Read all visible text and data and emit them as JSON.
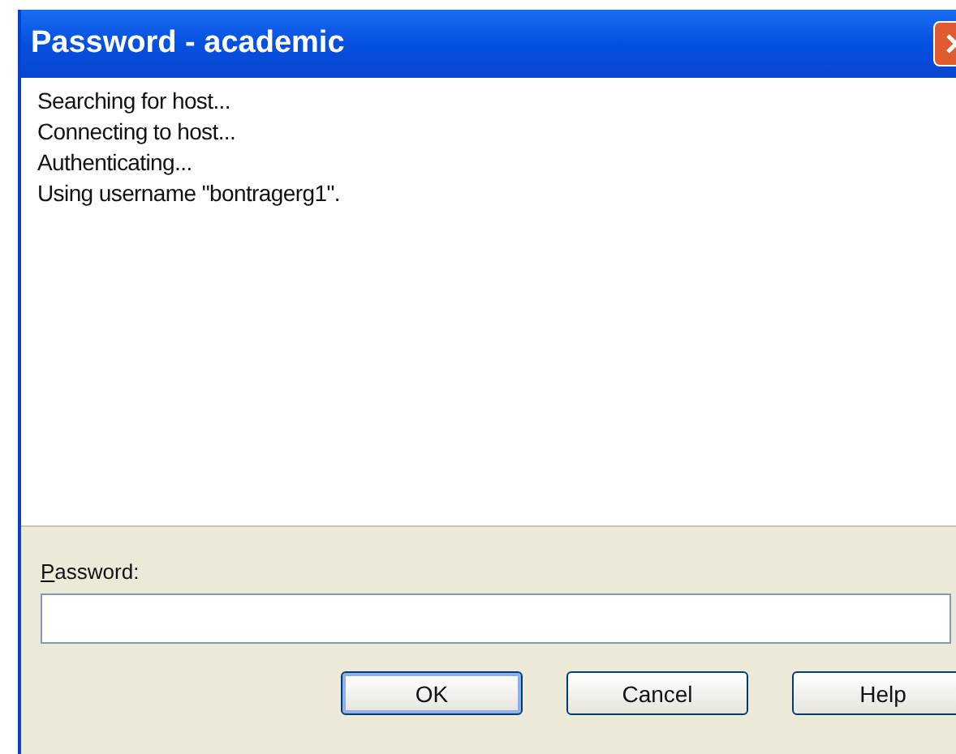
{
  "window": {
    "title": "Password - academic"
  },
  "log": [
    "Searching for host...",
    "Connecting to host...",
    "Authenticating...",
    "Using username \"bontragerg1\"."
  ],
  "password": {
    "label": "Password:"
  },
  "buttons": [
    {
      "label": "OK",
      "default": true
    },
    {
      "label": "Cancel",
      "default": false
    },
    {
      "label": "Help",
      "default": false
    }
  ]
}
